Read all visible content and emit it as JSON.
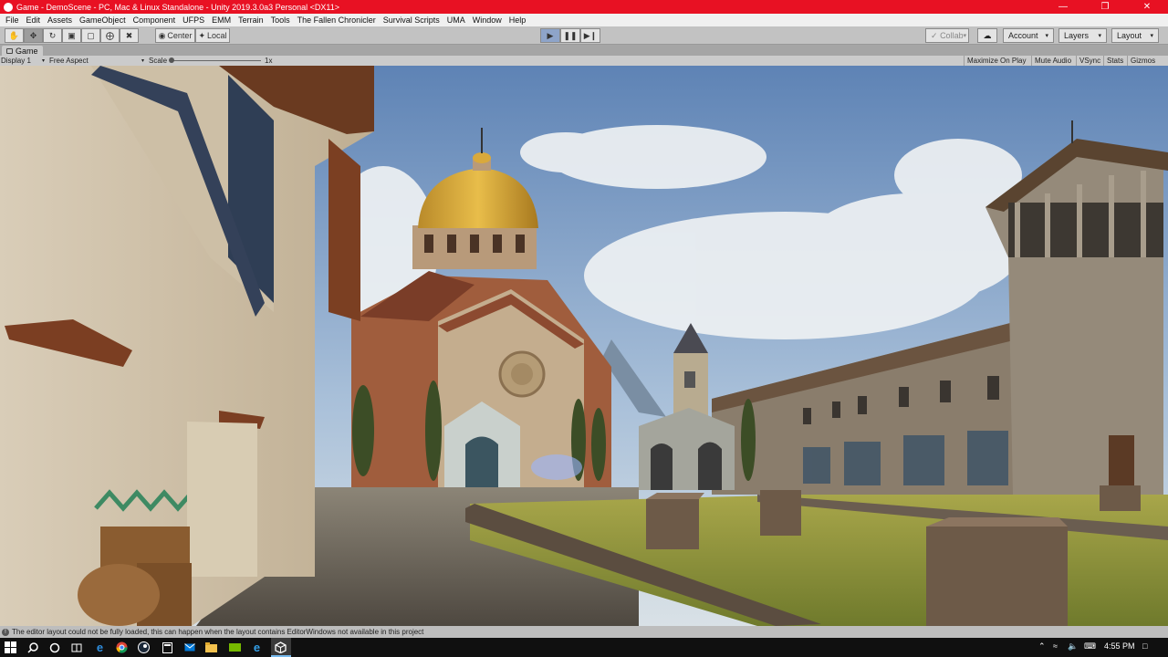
{
  "window": {
    "title": "Game - DemoScene - PC, Mac & Linux Standalone - Unity 2019.3.0a3 Personal <DX11>",
    "controls": [
      "minimize",
      "maximize",
      "close"
    ]
  },
  "menu": [
    "File",
    "Edit",
    "Assets",
    "GameObject",
    "Component",
    "UFPS",
    "EMM",
    "Terrain",
    "Tools",
    "The Fallen Chronicler",
    "Survival Scripts",
    "UMA",
    "Window",
    "Help"
  ],
  "toolbar": {
    "tools": [
      "hand-tool",
      "move-tool",
      "rotate-tool",
      "scale-tool",
      "rect-tool",
      "transform-tool",
      "custom-tool"
    ],
    "pivot_label": "Center",
    "rotation_label": "Local",
    "collab_label": "Collab",
    "account_label": "Account",
    "layers_label": "Layers",
    "layout_label": "Layout"
  },
  "game_tab": {
    "label": "Game"
  },
  "game_view": {
    "display": "Display 1",
    "aspect": "Free Aspect",
    "scale_label": "Scale",
    "scale_value": "1x",
    "scale_fraction": 0.0,
    "options": [
      "Maximize On Play",
      "Mute Audio",
      "VSync",
      "Stats",
      "Gizmos"
    ]
  },
  "status": {
    "message": "The editor layout could not be fully loaded, this can happen when the layout contains EditorWindows not available in this project"
  },
  "taskbar": {
    "clock": "4:55 PM",
    "apps": [
      "start-icon",
      "search-icon",
      "cortana-icon",
      "task-view-icon",
      "edge-icon",
      "chrome-icon",
      "steam-icon",
      "calculator-icon",
      "mail-icon",
      "folder-icon",
      "nvidia-icon",
      "ie-icon",
      "unity-icon"
    ]
  },
  "colors": {
    "titlebar": "#e81123",
    "toolbar": "#c2c2c2",
    "sky": "#6d8fbb",
    "dome": "#d8a83a"
  }
}
